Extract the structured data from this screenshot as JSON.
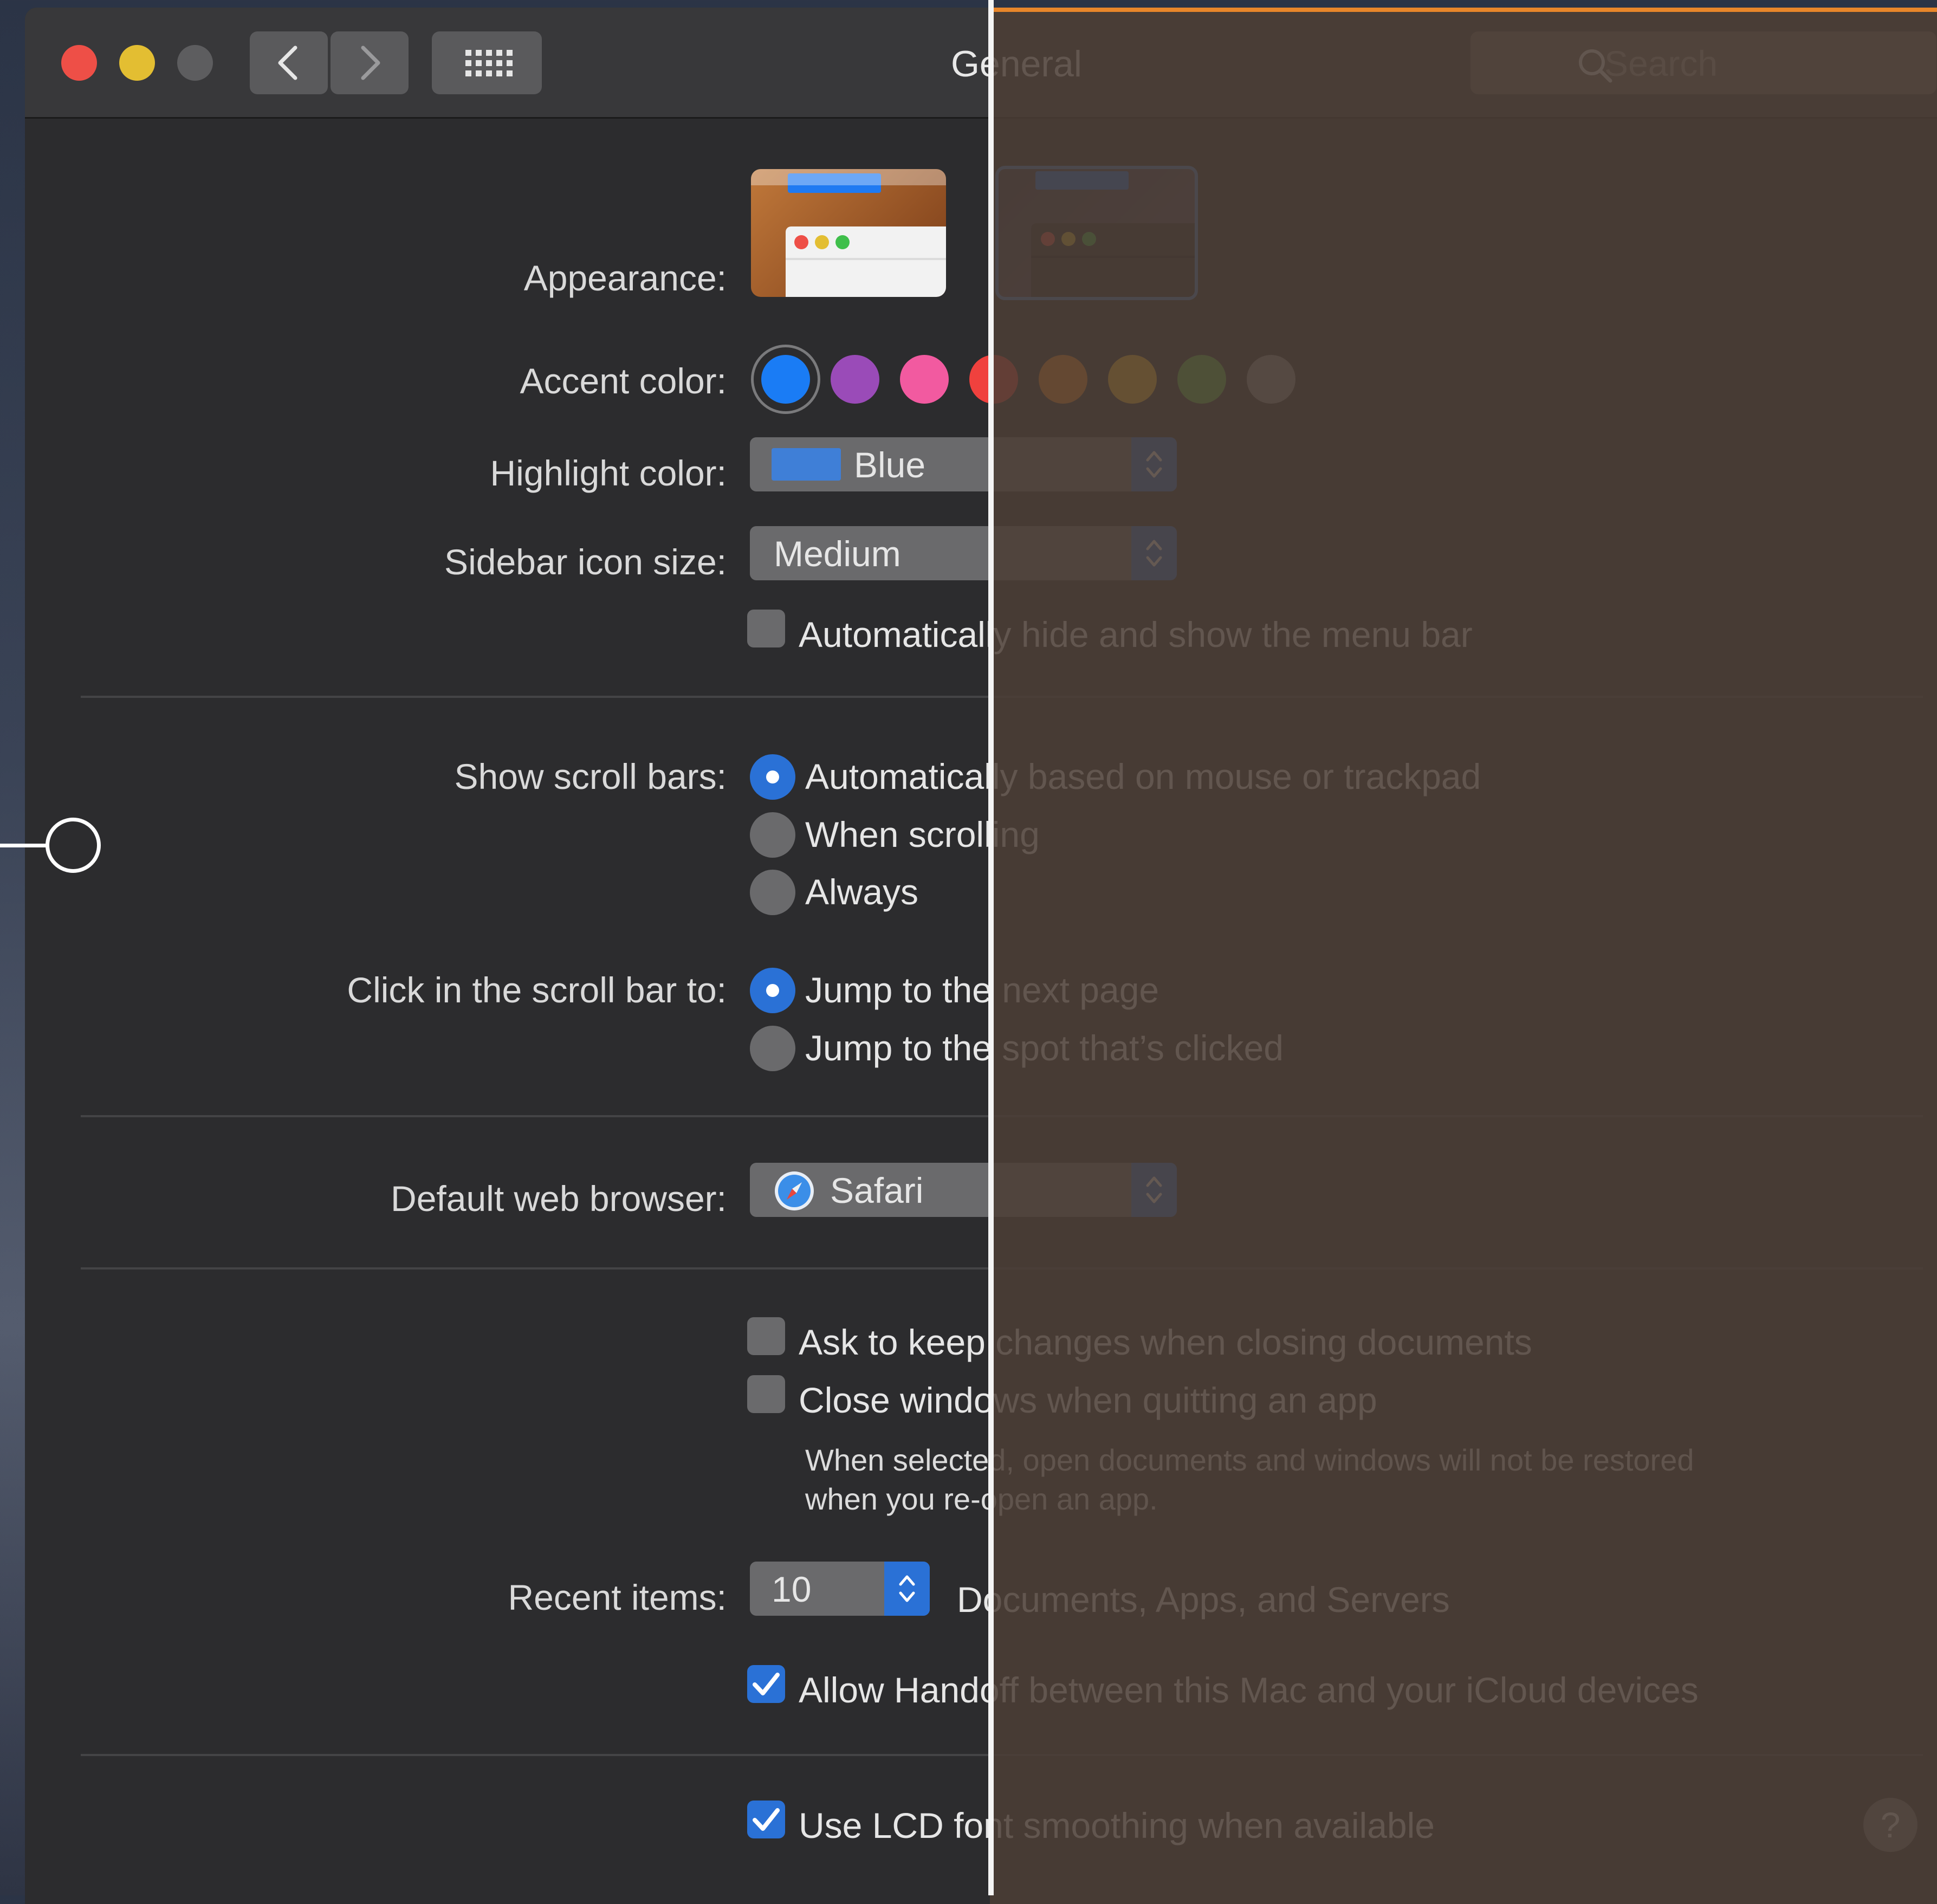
{
  "window": {
    "title": "General"
  },
  "toolbar": {
    "back_icon": "chevron-left-icon",
    "forward_icon": "chevron-right-icon",
    "grid_icon": "grid-icon",
    "search_placeholder": "Search"
  },
  "appearance": {
    "label": "Appearance:",
    "options": [
      "light",
      "dark"
    ],
    "selected": "dark"
  },
  "accent": {
    "label": "Accent color:",
    "colors": [
      "#1a7cf5",
      "#9a4bb8",
      "#f25aa0",
      "#f0413e",
      "#f58422",
      "#fbbd28",
      "#5ebe45",
      "#8d8d8f"
    ],
    "selected": 0
  },
  "highlight": {
    "label": "Highlight color:",
    "value": "Blue",
    "swatch": "#3f7fd7"
  },
  "sidebar_icon": {
    "label": "Sidebar icon size:",
    "value": "Medium"
  },
  "menubar": {
    "label": "Automatically hide and show the menu bar",
    "checked": false
  },
  "scroll_bars": {
    "label": "Show scroll bars:",
    "options": [
      "Automatically based on mouse or trackpad",
      "When scrolling",
      "Always"
    ],
    "selected": 0
  },
  "click_scroll": {
    "label": "Click in the scroll bar to:",
    "options": [
      "Jump to the next page",
      "Jump to the spot that’s clicked"
    ],
    "selected": 0
  },
  "browser": {
    "label": "Default web browser:",
    "value": "Safari",
    "icon": "safari-icon"
  },
  "ask_keep": {
    "label": "Ask to keep changes when closing documents",
    "checked": false
  },
  "close_windows": {
    "label": "Close windows when quitting an app",
    "checked": false,
    "note_line1": "When selected, open documents and windows will not be restored",
    "note_line2": "when you re-open an app."
  },
  "recent": {
    "label": "Recent items:",
    "value": "10",
    "suffix": "Documents, Apps, and Servers"
  },
  "handoff": {
    "label": "Allow Handoff between this Mac and your iCloud devices",
    "checked": true
  },
  "lcd": {
    "label": "Use LCD font smoothing when available",
    "checked": true
  },
  "help": {
    "label": "?"
  }
}
